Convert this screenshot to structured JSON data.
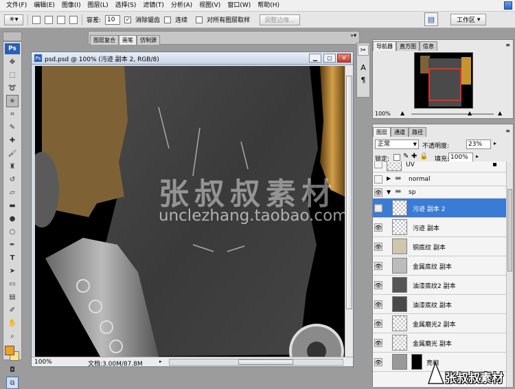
{
  "menu": [
    "文件(F)",
    "编辑(E)",
    "图像(I)",
    "图层(L)",
    "选择(S)",
    "滤镜(T)",
    "分析(A)",
    "视图(V)",
    "窗口(W)",
    "帮助(H)"
  ],
  "options": {
    "tolerance_label": "容差:",
    "tolerance_value": "10",
    "antialias_label": "消除锯齿",
    "contiguous_label": "连续",
    "all_layers_label": "对所有图层取样",
    "refine_label": "调整边缘...",
    "workspace_label": "工作区"
  },
  "tool_panel_tabs": [
    "图层复合",
    "画笔",
    "仿制源"
  ],
  "document": {
    "title": "psd.psd @ 100% (污迹 副本 2, RGB/8)",
    "zoom": "100%",
    "doc_info": "文档:3.00M/87.8M"
  },
  "watermark": {
    "cn": "张叔叔素材",
    "en": "unclezhang.taobao.com"
  },
  "navigator": {
    "tabs": [
      "导航器",
      "直方图",
      "信息"
    ],
    "zoom": "100%"
  },
  "layers_panel": {
    "tabs": [
      "图层",
      "通道",
      "路径"
    ],
    "blend_mode": "正常",
    "opacity_label": "不透明度:",
    "opacity_value": "23%",
    "lock_label": "锁定:",
    "fill_label": "填充:",
    "fill_value": "100%",
    "layers": [
      {
        "name": "UV",
        "type": "layer",
        "visible": false
      },
      {
        "name": "normal",
        "type": "group",
        "visible": false
      },
      {
        "name": "sp",
        "type": "group",
        "visible": true
      },
      {
        "name": "污迹 副本 2",
        "type": "layer",
        "visible": true,
        "selected": true
      },
      {
        "name": "污迹 副本",
        "type": "layer",
        "visible": true
      },
      {
        "name": "铜底纹 副本",
        "type": "layer",
        "visible": true
      },
      {
        "name": "金属底纹 副本",
        "type": "layer",
        "visible": true
      },
      {
        "name": "油漆底纹2 副本",
        "type": "layer",
        "visible": true
      },
      {
        "name": "油漆底纹 副本",
        "type": "layer",
        "visible": true
      },
      {
        "name": "金属磨光2 副本",
        "type": "layer",
        "visible": true
      },
      {
        "name": "金属磨光 副本",
        "type": "layer",
        "visible": true
      },
      {
        "name": "亮相",
        "type": "layer",
        "visible": true
      }
    ]
  },
  "corner_logo": {
    "text": "张叔叔素材"
  },
  "colors": {
    "selected_row": "#3a7bd5",
    "copper": "#8a6a38",
    "gold": "#c8942e",
    "foreground_swatch": "#f0a020"
  }
}
